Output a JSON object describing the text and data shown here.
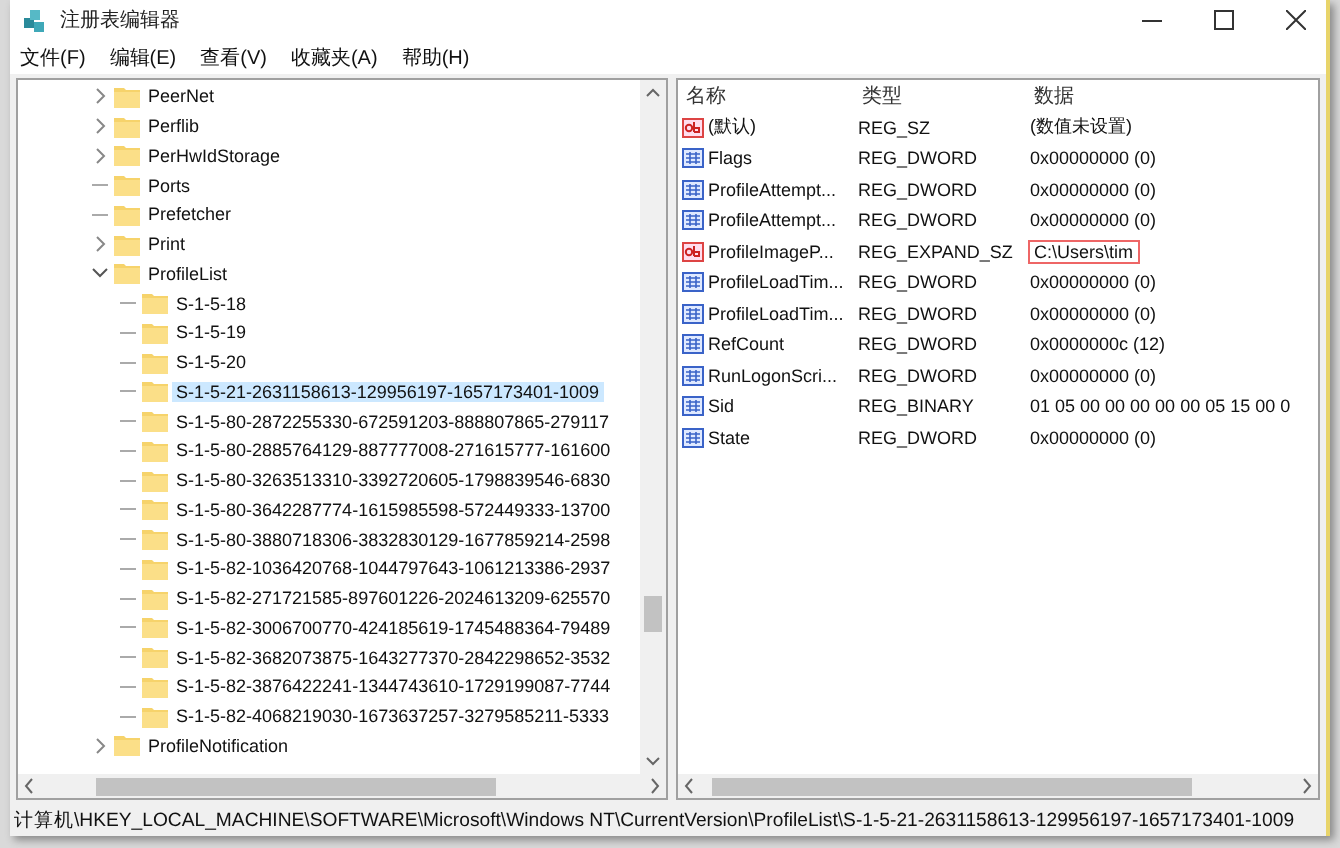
{
  "window": {
    "title": "注册表编辑器"
  },
  "menu": [
    {
      "label": "文件(F)"
    },
    {
      "label": "编辑(E)"
    },
    {
      "label": "查看(V)"
    },
    {
      "label": "收藏夹(A)"
    },
    {
      "label": "帮助(H)"
    }
  ],
  "tree": {
    "items": [
      {
        "label": "PeerNet",
        "kind": "collapsed",
        "selected": false
      },
      {
        "label": "Perflib",
        "kind": "collapsed",
        "selected": false
      },
      {
        "label": "PerHwIdStorage",
        "kind": "collapsed",
        "selected": false
      },
      {
        "label": "Ports",
        "kind": "leaf",
        "selected": false
      },
      {
        "label": "Prefetcher",
        "kind": "leaf",
        "selected": false
      },
      {
        "label": "Print",
        "kind": "collapsed",
        "selected": false
      },
      {
        "label": "ProfileList",
        "kind": "expanded",
        "selected": false,
        "children": [
          {
            "label": "S-1-5-18",
            "kind": "leaf",
            "selected": false
          },
          {
            "label": "S-1-5-19",
            "kind": "leaf",
            "selected": false
          },
          {
            "label": "S-1-5-20",
            "kind": "leaf",
            "selected": false
          },
          {
            "label": "S-1-5-21-2631158613-129956197-1657173401-1009",
            "kind": "leaf",
            "selected": true
          },
          {
            "label": "S-1-5-80-2872255330-672591203-888807865-279117",
            "kind": "leaf",
            "selected": false
          },
          {
            "label": "S-1-5-80-2885764129-887777008-271615777-161600",
            "kind": "leaf",
            "selected": false
          },
          {
            "label": "S-1-5-80-3263513310-3392720605-1798839546-6830",
            "kind": "leaf",
            "selected": false
          },
          {
            "label": "S-1-5-80-3642287774-1615985598-572449333-13700",
            "kind": "leaf",
            "selected": false
          },
          {
            "label": "S-1-5-80-3880718306-3832830129-1677859214-2598",
            "kind": "leaf",
            "selected": false
          },
          {
            "label": "S-1-5-82-1036420768-1044797643-1061213386-2937",
            "kind": "leaf",
            "selected": false
          },
          {
            "label": "S-1-5-82-271721585-897601226-2024613209-625570",
            "kind": "leaf",
            "selected": false
          },
          {
            "label": "S-1-5-82-3006700770-424185619-1745488364-79489",
            "kind": "leaf",
            "selected": false
          },
          {
            "label": "S-1-5-82-3682073875-1643277370-2842298652-3532",
            "kind": "leaf",
            "selected": false
          },
          {
            "label": "S-1-5-82-3876422241-1344743610-1729199087-7744",
            "kind": "leaf",
            "selected": false
          },
          {
            "label": "S-1-5-82-4068219030-1673637257-3279585211-5333",
            "kind": "leaf",
            "selected": false
          }
        ]
      },
      {
        "label": "ProfileNotification",
        "kind": "collapsed",
        "selected": false
      }
    ]
  },
  "values": {
    "columns": [
      "名称",
      "类型",
      "数据"
    ],
    "rows": [
      {
        "name": "(默认)",
        "type": "REG_SZ",
        "data": "(数值未设置)",
        "kind": "string",
        "highlighted": false
      },
      {
        "name": "Flags",
        "type": "REG_DWORD",
        "data": "0x00000000 (0)",
        "kind": "binary",
        "highlighted": false
      },
      {
        "name": "ProfileAttempt...",
        "type": "REG_DWORD",
        "data": "0x00000000 (0)",
        "kind": "binary",
        "highlighted": false
      },
      {
        "name": "ProfileAttempt...",
        "type": "REG_DWORD",
        "data": "0x00000000 (0)",
        "kind": "binary",
        "highlighted": false
      },
      {
        "name": "ProfileImageP...",
        "type": "REG_EXPAND_SZ",
        "data": "C:\\Users\\tim",
        "kind": "string",
        "highlighted": true
      },
      {
        "name": "ProfileLoadTim...",
        "type": "REG_DWORD",
        "data": "0x00000000 (0)",
        "kind": "binary",
        "highlighted": false
      },
      {
        "name": "ProfileLoadTim...",
        "type": "REG_DWORD",
        "data": "0x00000000 (0)",
        "kind": "binary",
        "highlighted": false
      },
      {
        "name": "RefCount",
        "type": "REG_DWORD",
        "data": "0x0000000c (12)",
        "kind": "binary",
        "highlighted": false
      },
      {
        "name": "RunLogonScri...",
        "type": "REG_DWORD",
        "data": "0x00000000 (0)",
        "kind": "binary",
        "highlighted": false
      },
      {
        "name": "Sid",
        "type": "REG_BINARY",
        "data": "01 05 00 00 00 00 00 05 15 00 0",
        "kind": "binary",
        "highlighted": false
      },
      {
        "name": "State",
        "type": "REG_DWORD",
        "data": "0x00000000 (0)",
        "kind": "binary",
        "highlighted": false
      }
    ]
  },
  "status_bar": "计算机\\HKEY_LOCAL_MACHINE\\SOFTWARE\\Microsoft\\Windows NT\\CurrentVersion\\ProfileList\\S-1-5-21-2631158613-129956197-1657173401-1009"
}
